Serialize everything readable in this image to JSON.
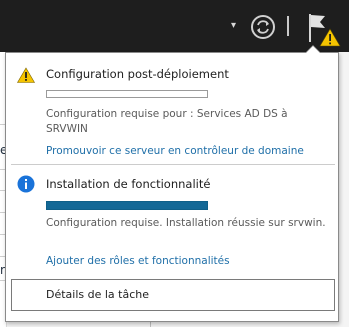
{
  "toolbar": {
    "dropdown_glyph": "▾",
    "refresh_icon": "refresh-icon",
    "flag_icon": "flag-warning-icon"
  },
  "background": {
    "edge_chars": [
      "e",
      "r"
    ]
  },
  "notifications": [
    {
      "icon": "warning-icon",
      "title": "Configuration post-déploiement",
      "progress_percent": 0,
      "desc_line1": "Configuration requise pour : Services AD DS à",
      "desc_line2": "SRVWIN",
      "link": "Promouvoir ce serveur en contrôleur de domaine"
    },
    {
      "icon": "info-icon",
      "title": "Installation de fonctionnalité",
      "progress_percent": 100,
      "desc_line1": "Configuration requise. Installation réussie sur srvwin.",
      "link": "Ajouter des rôles et fonctionnalités"
    }
  ],
  "task_details_label": "Détails de la tâche",
  "colors": {
    "topbar": "#1e1e1e",
    "link": "#1f6fa8",
    "progress": "#136896",
    "warning": "#f5c400",
    "info": "#1a73d9"
  }
}
